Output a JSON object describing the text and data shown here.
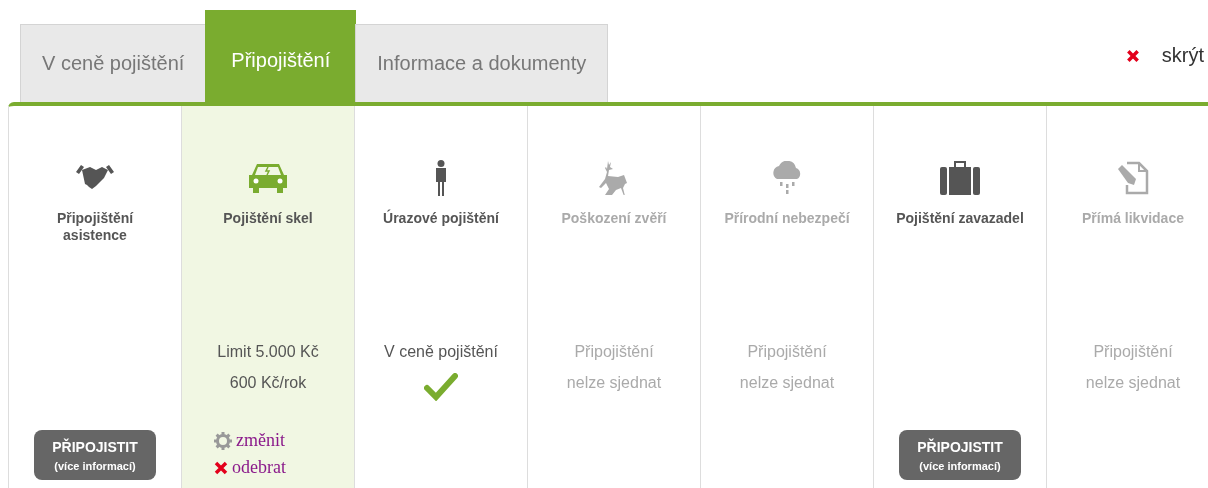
{
  "tabs": [
    {
      "label": "V ceně pojištění",
      "selected": false
    },
    {
      "label": "Připojištění",
      "selected": true
    },
    {
      "label": "Informace a dokumenty",
      "selected": false
    }
  ],
  "hide_link": {
    "label": "skrýt"
  },
  "columns": [
    {
      "title": "Připojištění asistence",
      "disabled": false,
      "selected": false,
      "kind": "offer",
      "button": {
        "label": "PŘIPOJISTIT",
        "sublabel": "(více informací)"
      }
    },
    {
      "title": "Pojištění skel",
      "disabled": false,
      "selected": true,
      "kind": "price",
      "lines": [
        "Limit 5.000 Kč",
        "600 Kč/rok"
      ],
      "actions": [
        {
          "label": "změnit",
          "kind": "change"
        },
        {
          "label": "odebrat",
          "kind": "remove"
        }
      ]
    },
    {
      "title": "Úrazové pojištění",
      "disabled": false,
      "selected": false,
      "kind": "included",
      "lines": [
        "V ceně pojištění"
      ]
    },
    {
      "title": "Poškození zvěří",
      "disabled": true,
      "selected": false,
      "kind": "unavailable",
      "lines": [
        "Připojištění",
        "nelze sjednat"
      ]
    },
    {
      "title": "Přírodní nebezpečí",
      "disabled": true,
      "selected": false,
      "kind": "unavailable",
      "lines": [
        "Připojištění",
        "nelze sjednat"
      ]
    },
    {
      "title": "Pojištění zavazadel",
      "disabled": false,
      "selected": false,
      "kind": "offer",
      "button": {
        "label": "PŘIPOJISTIT",
        "sublabel": "(více informací)"
      }
    },
    {
      "title": "Přímá likvidace",
      "disabled": true,
      "selected": false,
      "kind": "unavailable",
      "lines": [
        "Připojištění",
        "nelze sjednat"
      ]
    }
  ]
}
